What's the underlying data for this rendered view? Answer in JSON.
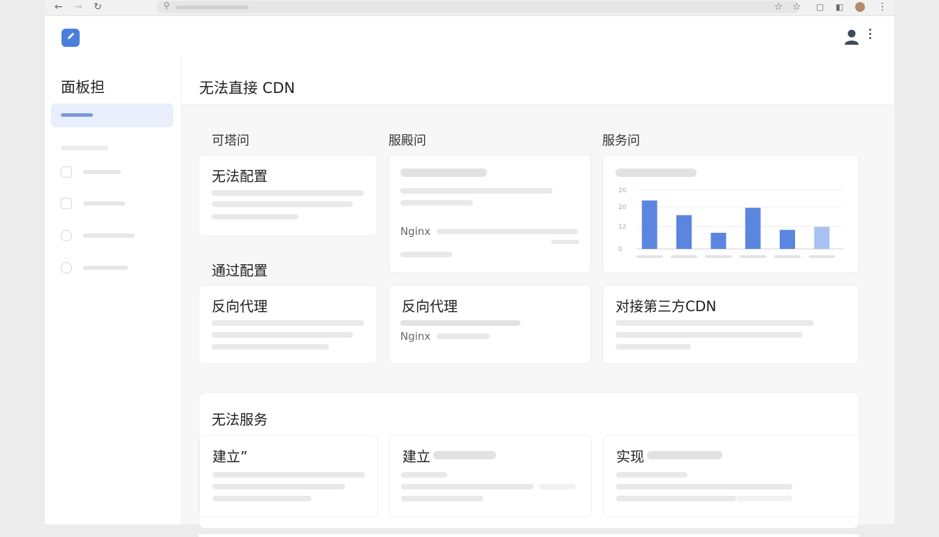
{
  "sidebar": {
    "title": "面板担"
  },
  "main": {
    "title": "无法直接 CDN",
    "columns": [
      "可塔问",
      "服殿问",
      "服务问"
    ],
    "cards_row1": [
      {
        "title": "无法配置"
      },
      {
        "label": "Nginx"
      }
    ],
    "group2_title": "通过配置",
    "cards_row2": [
      {
        "title": "反向代理"
      },
      {
        "title": "反向代理",
        "label": "Nginx"
      },
      {
        "title": "对接第三方CDN"
      }
    ],
    "section3": {
      "title": "无法服务",
      "cards": [
        {
          "title": "建立”"
        },
        {
          "title": "建立"
        },
        {
          "title": "实现"
        }
      ]
    }
  },
  "chart_data": {
    "type": "bar",
    "y_ticks": [
      "20",
      "20",
      "12",
      "0"
    ],
    "values": [
      16.5,
      11.5,
      5.5,
      14,
      6.5,
      7.5
    ],
    "ylim": [
      0,
      20
    ],
    "colors": [
      "#5b86e0",
      "#5b86e0",
      "#5b86e0",
      "#5b86e0",
      "#5b86e0",
      "#a8c1f1"
    ],
    "grid": true
  }
}
